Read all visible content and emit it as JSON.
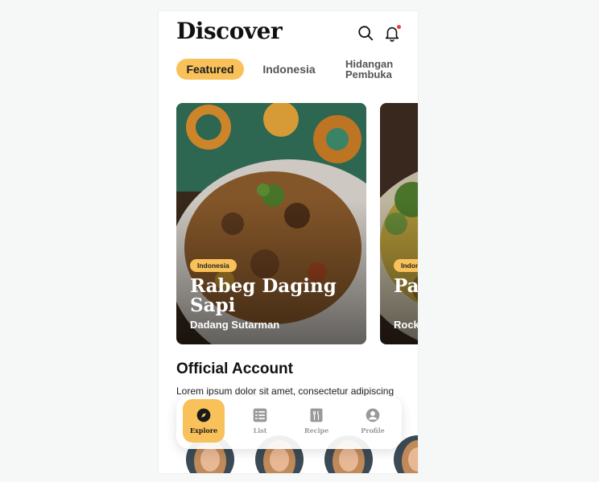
{
  "header": {
    "title": "Discover",
    "search_icon": "search-icon",
    "notification_icon": "bell-icon"
  },
  "tabs": [
    {
      "label": "Featured",
      "active": true
    },
    {
      "label": "Indonesia",
      "active": false
    },
    {
      "label_line1": "Hidangan",
      "label_line2": "Pembuka",
      "active": false
    }
  ],
  "cards": [
    {
      "category": "Indonesia",
      "title": "Rabeg Daging Sapi",
      "author": "Dadang Sutarman"
    },
    {
      "category": "Indonesia",
      "title": "Pa Ma",
      "author": "Rock"
    }
  ],
  "official_account": {
    "title": "Official Account",
    "description": "Lorem ipsum dolor sit amet, consectetur adipiscing"
  },
  "bottom_nav": [
    {
      "label": "Explore",
      "icon": "compass-icon",
      "active": true
    },
    {
      "label": "List",
      "icon": "list-icon",
      "active": false
    },
    {
      "label": "Recipe",
      "icon": "utensils-icon",
      "active": false
    },
    {
      "label": "Profile",
      "icon": "user-icon",
      "active": false
    }
  ],
  "colors": {
    "accent": "#f8c15a",
    "notification": "#e8403a",
    "background": "#f6f8f8"
  }
}
